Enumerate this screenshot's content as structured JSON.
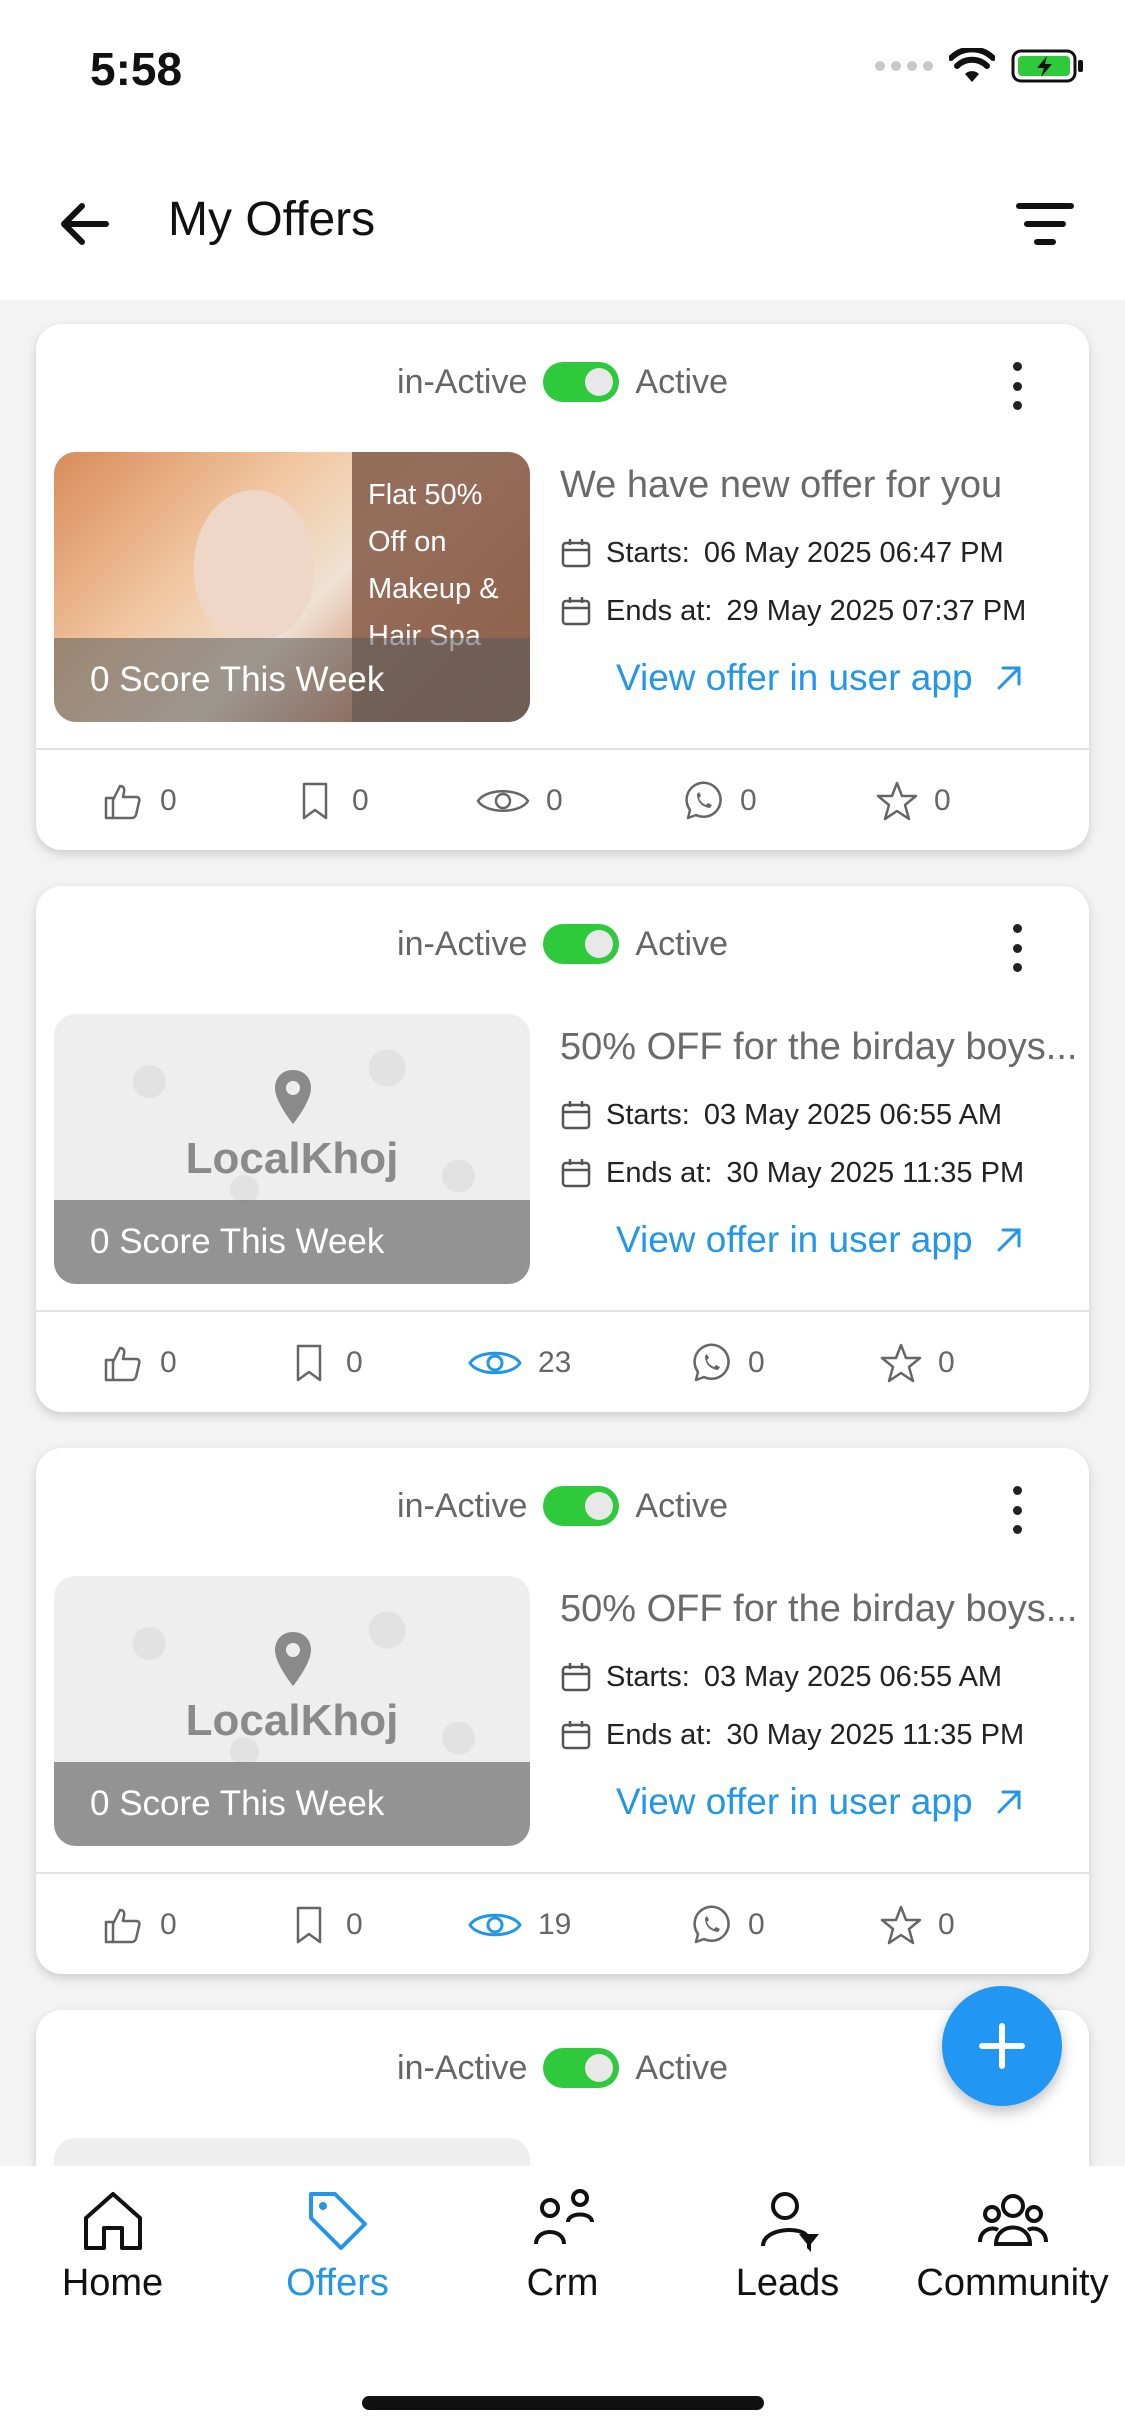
{
  "status_bar": {
    "time": "5:58"
  },
  "header": {
    "title": "My Offers"
  },
  "toggle": {
    "inactive_label": "in-Active",
    "active_label": "Active"
  },
  "offers": [
    {
      "title": "We have new offer for you",
      "starts_label": "Starts:",
      "starts": "06 May 2025 06:47 PM",
      "ends_label": "Ends at:",
      "ends": "29 May 2025 07:37 PM",
      "link": "View offer in user app",
      "score": "0 Score This Week",
      "image_text": "Flat 50% Off on Makeup & Hair Spa",
      "likes": "0",
      "saves": "0",
      "views": "0",
      "whatsapp": "0",
      "rating": "0",
      "views_highlight": false
    },
    {
      "title": "50% OFF for the birday boys...",
      "starts_label": "Starts:",
      "starts": "03 May 2025 06:55 AM",
      "ends_label": "Ends at:",
      "ends": "30 May 2025 11:35 PM",
      "link": "View offer in user app",
      "score": "0 Score This Week",
      "brand": "LocalKhoj",
      "likes": "0",
      "saves": "0",
      "views": "23",
      "whatsapp": "0",
      "rating": "0",
      "views_highlight": true
    },
    {
      "title": "50% OFF for the birday boys...",
      "starts_label": "Starts:",
      "starts": "03 May 2025 06:55 AM",
      "ends_label": "Ends at:",
      "ends": "30 May 2025 11:35 PM",
      "link": "View offer in user app",
      "score": "0 Score This Week",
      "brand": "LocalKhoj",
      "likes": "0",
      "saves": "0",
      "views": "19",
      "whatsapp": "0",
      "rating": "0",
      "views_highlight": true
    }
  ],
  "nav": {
    "items": [
      {
        "label": "Home",
        "icon": "home-icon"
      },
      {
        "label": "Offers",
        "icon": "tag-icon"
      },
      {
        "label": "Crm",
        "icon": "crm-icon"
      },
      {
        "label": "Leads",
        "icon": "leads-icon"
      },
      {
        "label": "Community",
        "icon": "community-icon"
      }
    ],
    "active_index": 1
  },
  "colors": {
    "accent": "#2496e8",
    "toggle_on": "#2fc93c",
    "fab": "#2196f3"
  }
}
